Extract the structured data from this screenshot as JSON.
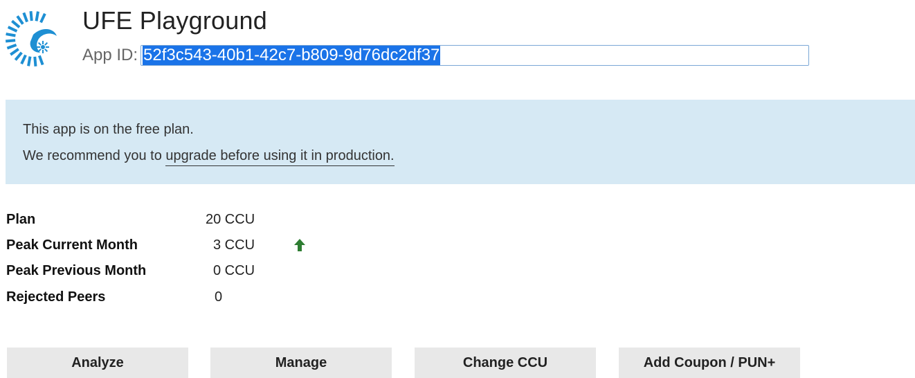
{
  "header": {
    "title": "UFE Playground",
    "app_id_label": "App ID:",
    "app_id_value": "52f3c543-40b1-42c7-b809-9d76dc2df37",
    "logo": "photon-logo-icon"
  },
  "notice": {
    "line1": "This app is on the free plan.",
    "line2_prefix": "We recommend you to ",
    "line2_link": "upgrade before using it in production."
  },
  "stats": [
    {
      "label": "Plan",
      "value": "20 CCU"
    },
    {
      "label": "Peak Current Month",
      "value": "3 CCU",
      "trend_icon": "up-arrow-icon",
      "trend_color": "#2e7d32"
    },
    {
      "label": "Peak Previous Month",
      "value": "0 CCU"
    },
    {
      "label": "Rejected Peers",
      "value": "0"
    }
  ],
  "buttons": {
    "analyze": "Analyze",
    "manage": "Manage",
    "change_ccu": "Change CCU",
    "add_coupon": "Add Coupon / PUN+"
  },
  "colors": {
    "notice_bg": "#d6e9f4",
    "selection": "#1a73e8",
    "logo": "#1e8fd3",
    "button_bg": "#e8e8e8"
  }
}
